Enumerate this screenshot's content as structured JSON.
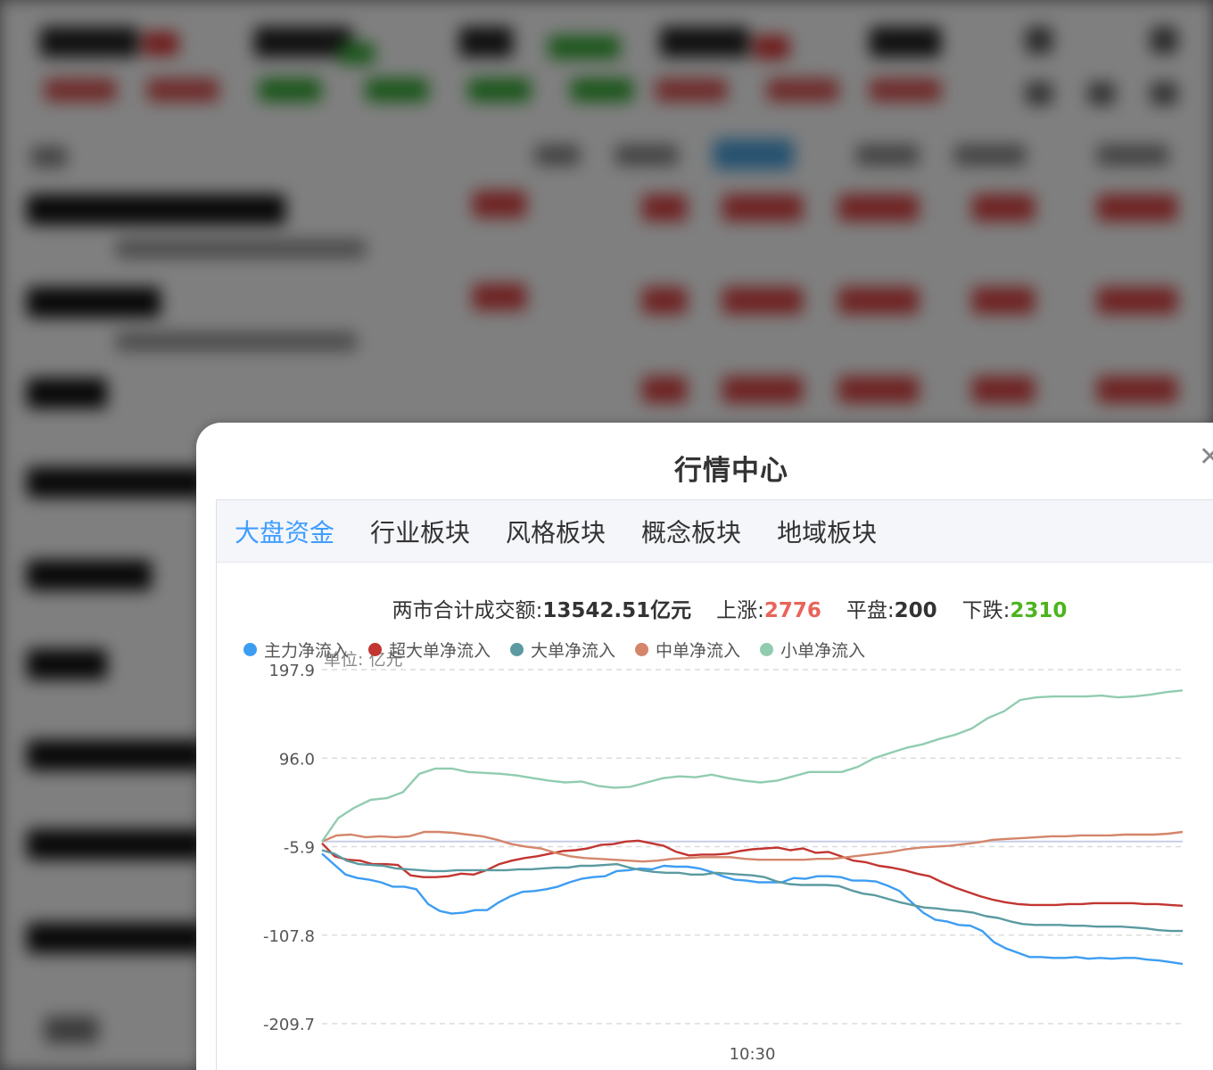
{
  "modal": {
    "title": "行情中心",
    "close_icon": "close-icon"
  },
  "tabs": [
    {
      "label": "大盘资金",
      "active": true
    },
    {
      "label": "行业板块",
      "active": false
    },
    {
      "label": "风格板块",
      "active": false
    },
    {
      "label": "概念板块",
      "active": false
    },
    {
      "label": "地域板块",
      "active": false
    }
  ],
  "stats": {
    "turnover_label": "两市合计成交额:",
    "turnover_value": "13542.51亿元",
    "up_label": "上涨:",
    "up_value": "2776",
    "flat_label": "平盘:",
    "flat_value": "200",
    "down_label": "下跌:",
    "down_value": "2310"
  },
  "colors": {
    "accent": "#409eff",
    "up": "#e8645a",
    "down": "#4db41e"
  },
  "chart_data": {
    "type": "line",
    "unit_label": "单位: 亿元",
    "y_ticks": [
      "197.9",
      "96.0",
      "-5.9",
      "-107.8",
      "-209.7"
    ],
    "ylim": [
      -209.7,
      197.9
    ],
    "zero_line": 0,
    "x_ticks": [
      "10:30"
    ],
    "x_tick_index": 60,
    "point_count": 121,
    "series": [
      {
        "name": "主力净流入",
        "color": "#3d9df2",
        "values": [
          -14,
          -26,
          -38,
          -42,
          -44,
          -47,
          -52,
          -52,
          -55,
          -72,
          -80,
          -83,
          -82,
          -79,
          -79,
          -70,
          -63,
          -58,
          -57,
          -55,
          -52,
          -47,
          -43,
          -41,
          -40,
          -34,
          -33,
          -31,
          -32,
          -28,
          -29,
          -29,
          -31,
          -35,
          -40,
          -44,
          -45,
          -47,
          -47,
          -47,
          -42,
          -43,
          -40,
          -40,
          -41,
          -45,
          -45,
          -46,
          -51,
          -57,
          -70,
          -82,
          -90,
          -92,
          -96,
          -97,
          -103,
          -116,
          -123,
          -128,
          -133,
          -133,
          -134,
          -134,
          -133,
          -135,
          -134,
          -135,
          -134,
          -134,
          -136,
          -137,
          -139,
          -141
        ]
      },
      {
        "name": "超大单净流入",
        "color": "#c23531",
        "values": [
          -2,
          -17,
          -21,
          -22,
          -26,
          -26,
          -27,
          -39,
          -41,
          -41,
          -40,
          -37,
          -38,
          -33,
          -26,
          -22,
          -19,
          -17,
          -14,
          -11,
          -10,
          -8,
          -4,
          -3,
          0,
          1,
          -2,
          -5,
          -12,
          -16,
          -15,
          -15,
          -14,
          -11,
          -9,
          -8,
          -7,
          -10,
          -8,
          -13,
          -12,
          -17,
          -22,
          -24,
          -28,
          -30,
          -33,
          -37,
          -40,
          -47,
          -53,
          -58,
          -63,
          -67,
          -70,
          -72,
          -73,
          -73,
          -73,
          -72,
          -72,
          -71,
          -71,
          -71,
          -71,
          -72,
          -72,
          -73,
          -74
        ]
      },
      {
        "name": "大单净流入",
        "color": "#5b9aa0",
        "values": [
          -10,
          -14,
          -22,
          -26,
          -27,
          -28,
          -31,
          -32,
          -33,
          -34,
          -34,
          -33,
          -33,
          -33,
          -33,
          -33,
          -32,
          -32,
          -31,
          -30,
          -30,
          -28,
          -28,
          -27,
          -26,
          -30,
          -33,
          -35,
          -36,
          -36,
          -38,
          -38,
          -36,
          -37,
          -38,
          -39,
          -41,
          -46,
          -49,
          -50,
          -50,
          -50,
          -51,
          -56,
          -60,
          -62,
          -66,
          -70,
          -73,
          -76,
          -77,
          -79,
          -80,
          -82,
          -86,
          -88,
          -92,
          -95,
          -96,
          -96,
          -96,
          -97,
          -97,
          -98,
          -98,
          -98,
          -99,
          -100,
          -102,
          -103,
          -103
        ]
      },
      {
        "name": "中单净流入",
        "color": "#d4856a",
        "values": [
          0,
          7,
          8,
          5,
          6,
          5,
          6,
          11,
          11,
          10,
          8,
          6,
          2,
          -3,
          -6,
          -8,
          -13,
          -17,
          -19,
          -20,
          -21,
          -22,
          -23,
          -22,
          -20,
          -19,
          -18,
          -18,
          -18,
          -20,
          -21,
          -21,
          -21,
          -21,
          -20,
          -20,
          -18,
          -16,
          -14,
          -12,
          -9,
          -7,
          -6,
          -5,
          -3,
          -1,
          2,
          3,
          4,
          5,
          6,
          6,
          7,
          7,
          7,
          8,
          8,
          8,
          9,
          11
        ]
      },
      {
        "name": "小单净流入",
        "color": "#91ccb0",
        "values": [
          0,
          27,
          39,
          48,
          50,
          57,
          78,
          84,
          84,
          80,
          79,
          78,
          76,
          73,
          70,
          68,
          69,
          64,
          62,
          63,
          68,
          73,
          75,
          74,
          77,
          73,
          70,
          68,
          70,
          75,
          80,
          80,
          80,
          86,
          96,
          102,
          108,
          112,
          118,
          123,
          130,
          142,
          150,
          163,
          166,
          167,
          167,
          167,
          168,
          166,
          167,
          169,
          172,
          174
        ]
      }
    ]
  },
  "background": {
    "description_free": true
  }
}
